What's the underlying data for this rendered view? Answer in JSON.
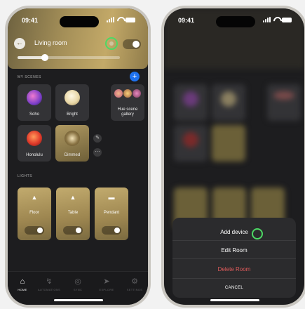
{
  "status": {
    "time": "09:41"
  },
  "left": {
    "room_title": "Living room",
    "brightness_level": 0.27,
    "room_on": true,
    "scenes_label": "MY SCENES",
    "add_icon": "+",
    "scenes": [
      {
        "label": "Soho"
      },
      {
        "label": "Bright"
      },
      {
        "label": "Hue scene gallery"
      },
      {
        "label": "Honolulu"
      },
      {
        "label": "Dimmed"
      }
    ],
    "lights_label": "LIGHTS",
    "lights": [
      {
        "label": "Floor"
      },
      {
        "label": "Table"
      },
      {
        "label": "Pendant"
      }
    ],
    "tabs": [
      {
        "label": "HOME",
        "icon": "home-icon"
      },
      {
        "label": "AUTOMATIONS",
        "icon": "lightning-icon"
      },
      {
        "label": "SYNC",
        "icon": "sync-icon"
      },
      {
        "label": "EXPLORE",
        "icon": "rocket-icon"
      },
      {
        "label": "SETTINGS",
        "icon": "gear-icon"
      }
    ]
  },
  "right": {
    "status_time": "09:41",
    "sheet": {
      "add_device": "Add device",
      "edit_room": "Edit Room",
      "delete_room": "Delete Room",
      "cancel": "CANCEL"
    }
  },
  "colors": {
    "accent_blue": "#1e72f0",
    "highlight_green": "#4cd964",
    "danger": "#e25c5c",
    "gold": "#b09a62"
  }
}
